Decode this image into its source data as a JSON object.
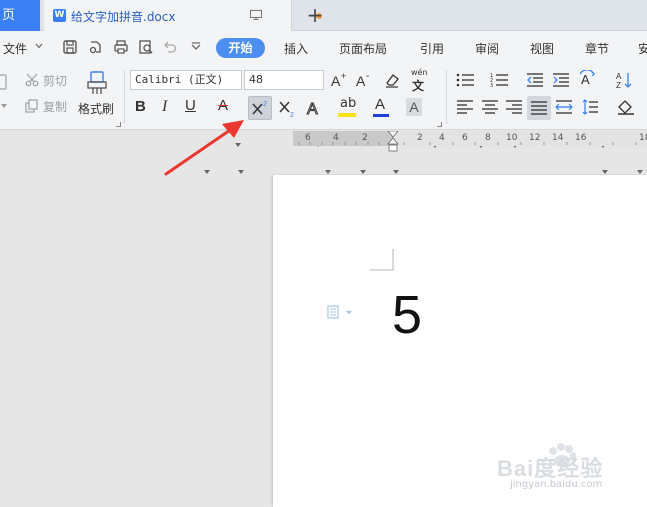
{
  "tabbar": {
    "home_label": "页",
    "doc_icon_letter": "W",
    "doc_title": "给文字加拼音.docx",
    "new_tab_icon": "plus-icon",
    "unsaved_dot_color": "#f39c3a"
  },
  "menu": {
    "file_label": "文件",
    "active_tab": "开始",
    "tabs": [
      "插入",
      "页面布局",
      "引用",
      "审阅",
      "视图",
      "章节",
      "安"
    ]
  },
  "ribbon": {
    "cut_label": "剪切",
    "copy_label": "复制",
    "format_painter_label": "格式刷",
    "font_name": "Calibri (正文)",
    "font_size": "48",
    "pinyin_label": "wén"
  },
  "ruler": {
    "numbers": [
      "6",
      "4",
      "2",
      "2",
      "4",
      "6",
      "8",
      "10",
      "12",
      "14",
      "16",
      "18"
    ]
  },
  "document": {
    "content": "5"
  },
  "watermark": {
    "brand": "Bai度经验",
    "url": "jingyan.baidu.com"
  },
  "colors": {
    "accent": "#3a7ff3",
    "start_button": "#4d8ff0",
    "annotation_arrow": "#e8382f",
    "highlight_yellow": "#f7e11a",
    "font_color_blue": "#1f3fd6"
  }
}
